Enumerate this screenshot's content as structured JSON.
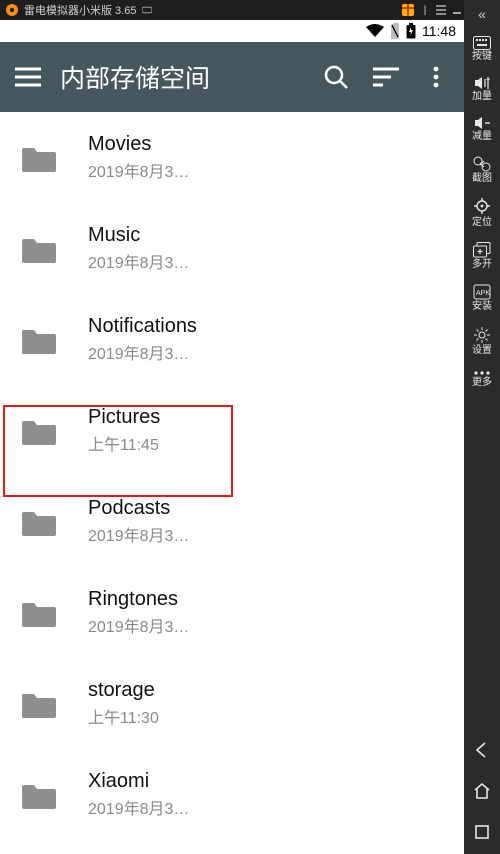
{
  "emu": {
    "title": "雷电模拟器小米版 3.65"
  },
  "status": {
    "time": "11:48"
  },
  "toolbar": {
    "title": "内部存储空间"
  },
  "folders": [
    {
      "name": "Movies",
      "date": "2019年8月3…"
    },
    {
      "name": "Music",
      "date": "2019年8月3…"
    },
    {
      "name": "Notifications",
      "date": "2019年8月3…"
    },
    {
      "name": "Pictures",
      "date": "上午11:45"
    },
    {
      "name": "Podcasts",
      "date": "2019年8月3…"
    },
    {
      "name": "Ringtones",
      "date": "2019年8月3…"
    },
    {
      "name": "storage",
      "date": "上午11:30"
    },
    {
      "name": "Xiaomi",
      "date": "2019年8月3…"
    }
  ],
  "sidebar": {
    "items": [
      {
        "label": "按键"
      },
      {
        "label": "加量"
      },
      {
        "label": "减量"
      },
      {
        "label": "截图"
      },
      {
        "label": "定位"
      },
      {
        "label": "多开"
      },
      {
        "label": "安装"
      },
      {
        "label": "设置"
      },
      {
        "label": "更多"
      }
    ]
  }
}
